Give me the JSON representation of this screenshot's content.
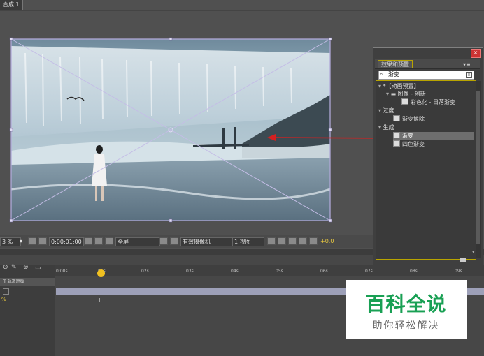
{
  "comp_tab": {
    "label": "合成 1"
  },
  "viewer_bar": {
    "zoom": "3 %",
    "timecode": "0:00:01:00",
    "resolution": "全屏",
    "camera": "有效摄像机",
    "views": "1 视图",
    "exposure": "+0.0"
  },
  "timeline": {
    "ruler_ticks": [
      "0:00s",
      "01s",
      "02s",
      "03s",
      "04s",
      "05s",
      "06s",
      "07s",
      "08s",
      "09s"
    ],
    "layer_name": "T  轨道遮板"
  },
  "effects_panel": {
    "tab_label": "效果和预置",
    "menu_glyph": "▾≡",
    "search_value": "渐变",
    "tree": [
      {
        "label": "*【动画预置】",
        "level": 0,
        "kind": "group"
      },
      {
        "label": "图像 - 创新",
        "level": 1,
        "kind": "folder"
      },
      {
        "label": "彩色化 - 日落渐变",
        "level": 2,
        "kind": "effect"
      },
      {
        "label": "过度",
        "level": 0,
        "kind": "group"
      },
      {
        "label": "渐变擦除",
        "level": 1,
        "kind": "effect"
      },
      {
        "label": "生成",
        "level": 0,
        "kind": "group"
      },
      {
        "label": "渐变",
        "level": 1,
        "kind": "effect",
        "selected": true
      },
      {
        "label": "四色渐变",
        "level": 1,
        "kind": "effect"
      }
    ]
  },
  "watermark": {
    "title": "百科全说",
    "subtitle": "助你轻松解决"
  },
  "colors": {
    "accent_yellow": "#b8a400",
    "playhead_red": "#dd2222",
    "watermark_green": "#19a054"
  }
}
